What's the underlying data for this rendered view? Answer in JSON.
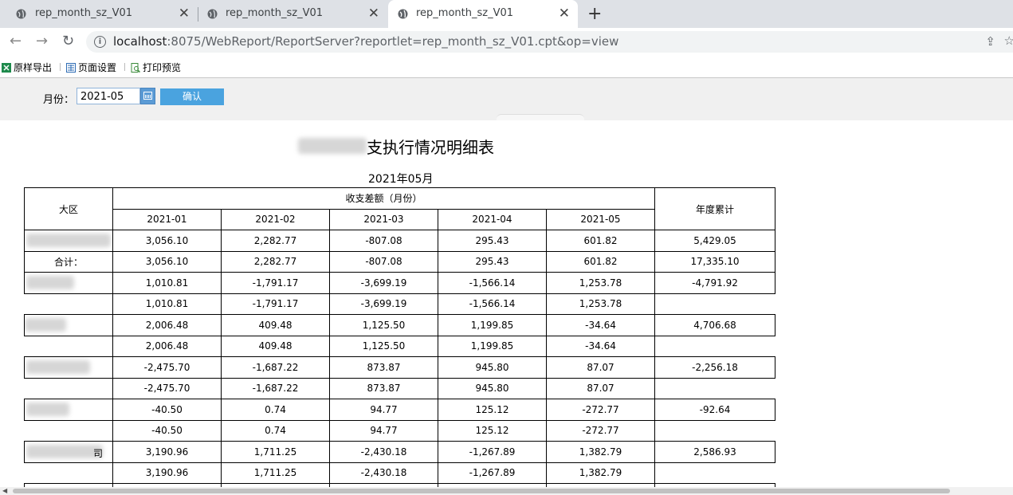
{
  "browser": {
    "tabs": [
      {
        "title": "rep_month_sz_V01",
        "active": false
      },
      {
        "title": "rep_month_sz_V01",
        "active": false
      },
      {
        "title": "rep_month_sz_V01",
        "active": true
      }
    ],
    "url_host": "localhost",
    "url_rest": ":8075/WebReport/ReportServer?reportlet=rep_month_sz_V01.cpt&op=view"
  },
  "toolbar": {
    "export_label": "原样导出",
    "page_setup_label": "页面设置",
    "print_preview_label": "打印预览"
  },
  "params": {
    "month_label": "月份：",
    "month_value": "2021-05",
    "confirm_label": "确认"
  },
  "report": {
    "title": "支执行情况明细表",
    "subtitle": "2021年05月",
    "header": {
      "region": "大区",
      "group": "收支差额（月份）",
      "months": [
        "2021-01",
        "2021-02",
        "2021-03",
        "2021-04",
        "2021-05"
      ],
      "ytd": "年度累计"
    },
    "rows": [
      {
        "label": "",
        "values": [
          "3,056.10",
          "2,282.77",
          "-807.08",
          "295.43",
          "601.82"
        ],
        "ytd": "5,429.05",
        "boxed": true
      },
      {
        "label": "合计：",
        "values": [
          "3,056.10",
          "2,282.77",
          "-807.08",
          "295.43",
          "601.82"
        ],
        "ytd": "17,335.10",
        "boxed": true
      },
      {
        "label": "",
        "values": [
          "1,010.81",
          "-1,791.17",
          "-3,699.19",
          "-1,566.14",
          "1,253.78"
        ],
        "ytd": "-4,791.92",
        "boxed": true
      },
      {
        "label": "",
        "values": [
          "1,010.81",
          "-1,791.17",
          "-3,699.19",
          "-1,566.14",
          "1,253.78"
        ],
        "ytd": "",
        "boxed": false
      },
      {
        "label": "",
        "values": [
          "2,006.48",
          "409.48",
          "1,125.50",
          "1,199.85",
          "-34.64"
        ],
        "ytd": "4,706.68",
        "boxed": true
      },
      {
        "label": "",
        "values": [
          "2,006.48",
          "409.48",
          "1,125.50",
          "1,199.85",
          "-34.64"
        ],
        "ytd": "",
        "boxed": false
      },
      {
        "label": "",
        "values": [
          "-2,475.70",
          "-1,687.22",
          "873.87",
          "945.80",
          "87.07"
        ],
        "ytd": "-2,256.18",
        "boxed": true
      },
      {
        "label": "",
        "values": [
          "-2,475.70",
          "-1,687.22",
          "873.87",
          "945.80",
          "87.07"
        ],
        "ytd": "",
        "boxed": false
      },
      {
        "label": "",
        "values": [
          "-40.50",
          "0.74",
          "94.77",
          "125.12",
          "-272.77"
        ],
        "ytd": "-92.64",
        "boxed": true
      },
      {
        "label": "",
        "values": [
          "-40.50",
          "0.74",
          "94.77",
          "125.12",
          "-272.77"
        ],
        "ytd": "",
        "boxed": false
      },
      {
        "label": "司",
        "values": [
          "3,190.96",
          "1,711.25",
          "-2,430.18",
          "-1,267.89",
          "1,382.79"
        ],
        "ytd": "2,586.93",
        "boxed": true
      },
      {
        "label": "",
        "values": [
          "3,190.96",
          "1,711.25",
          "-2,430.18",
          "-1,267.89",
          "1,382.79"
        ],
        "ytd": "",
        "boxed": false
      }
    ]
  }
}
